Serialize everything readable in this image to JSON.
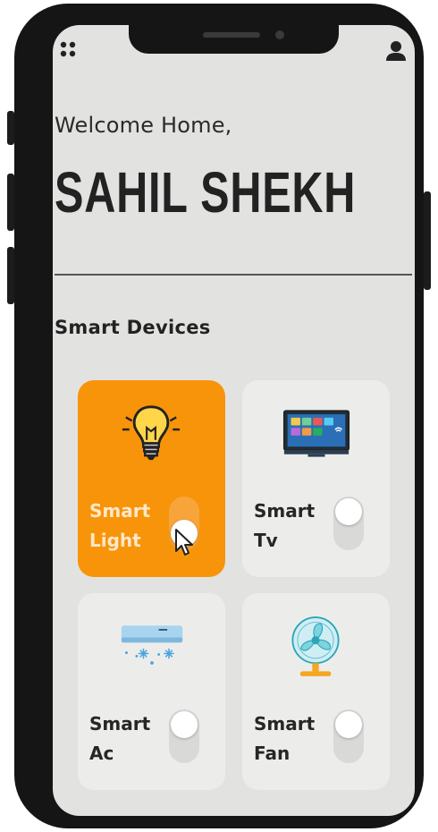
{
  "header": {
    "greeting": "Welcome Home,",
    "user_name": "SAHIL SHEKH",
    "menu_icon": "grid-dots-icon",
    "profile_icon": "user-icon"
  },
  "devices_section": {
    "title": "Smart Devices",
    "devices": [
      {
        "line1": "Smart",
        "line2": "Light",
        "icon": "lightbulb-icon",
        "on": true
      },
      {
        "line1": "Smart",
        "line2": "Tv",
        "icon": "tv-icon",
        "on": false
      },
      {
        "line1": "Smart",
        "line2": "Ac",
        "icon": "air-conditioner-icon",
        "on": false
      },
      {
        "line1": "Smart",
        "line2": "Fan",
        "icon": "fan-icon",
        "on": false
      }
    ]
  },
  "colors": {
    "accent": "#f8940a",
    "screen_background": "#e2e3e1",
    "card_background": "#ecedeb",
    "text_primary": "#222222"
  }
}
